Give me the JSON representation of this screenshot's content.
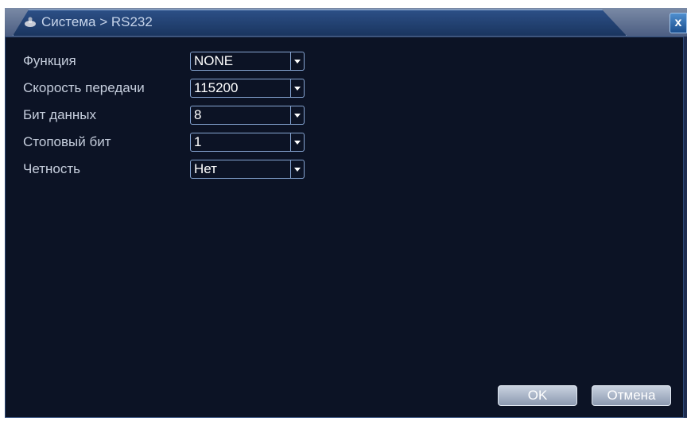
{
  "window": {
    "title": "Система > RS232",
    "close_label": "x"
  },
  "fields": [
    {
      "label": "Функция",
      "value": "NONE"
    },
    {
      "label": "Скорость передачи",
      "value": "115200"
    },
    {
      "label": "Бит данных",
      "value": "8"
    },
    {
      "label": "Стоповый бит",
      "value": "1"
    },
    {
      "label": "Четность",
      "value": "Нет"
    }
  ],
  "buttons": {
    "ok": "OK",
    "cancel": "Отмена"
  },
  "colors": {
    "panel_bg": "#0c1325",
    "title_bar": "#2c4f86",
    "select_border": "#86a5d2"
  }
}
